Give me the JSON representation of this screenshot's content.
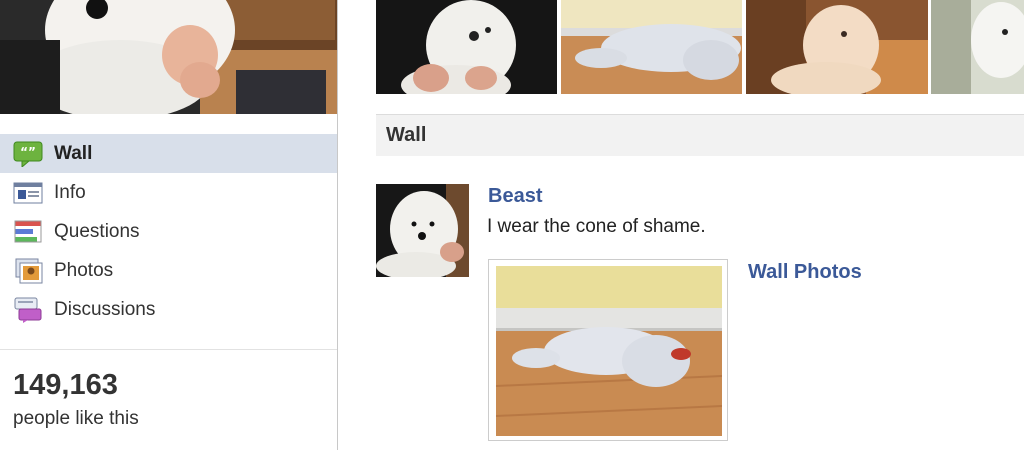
{
  "nav": {
    "items": [
      {
        "label": "Wall",
        "icon": "wall-icon",
        "active": true
      },
      {
        "label": "Info",
        "icon": "info-icon",
        "active": false
      },
      {
        "label": "Questions",
        "icon": "questions-icon",
        "active": false
      },
      {
        "label": "Photos",
        "icon": "photos-icon",
        "active": false
      },
      {
        "label": "Discussions",
        "icon": "discussions-icon",
        "active": false
      }
    ]
  },
  "likes": {
    "count": "149,163",
    "text": "people like this"
  },
  "section": {
    "title": "Wall"
  },
  "post": {
    "author": "Beast",
    "text": "I wear the cone of shame.",
    "album_link": "Wall Photos"
  },
  "colors": {
    "link": "#3b5998",
    "nav_active_bg": "#d8dfea",
    "section_header_bg": "#f2f2f2"
  }
}
